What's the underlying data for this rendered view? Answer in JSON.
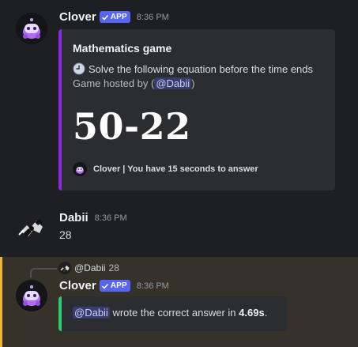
{
  "messages": [
    {
      "author": "Clover",
      "badge": "APP",
      "time": "8:36 PM",
      "embed": {
        "title": "Mathematics game",
        "description": "Solve the following equation before the time ends",
        "host_prefix": "Game hosted by (",
        "host_mention": "@Dabii",
        "host_suffix": ")",
        "equation": "50-22",
        "footer": "Clover | You have 15 seconds to answer",
        "color": "#8a2be2"
      }
    },
    {
      "author": "Dabii",
      "time": "8:36 PM",
      "content": "28"
    },
    {
      "reply": {
        "user": "@Dabii",
        "text": "28"
      },
      "author": "Clover",
      "badge": "APP",
      "time": "8:36 PM",
      "embed": {
        "mention": "@Dabii",
        "text": "wrote the correct answer in",
        "time_value": "4.69s",
        "end": ".",
        "color": "#2ecc71"
      }
    }
  ],
  "colors": {
    "background": "#1e1f22",
    "highlight": "#f0b232",
    "badge": "#5865f2"
  },
  "icons": [
    "clover-bot-avatar",
    "dabii-avatar",
    "verified-check-icon",
    "clock-icon"
  ]
}
